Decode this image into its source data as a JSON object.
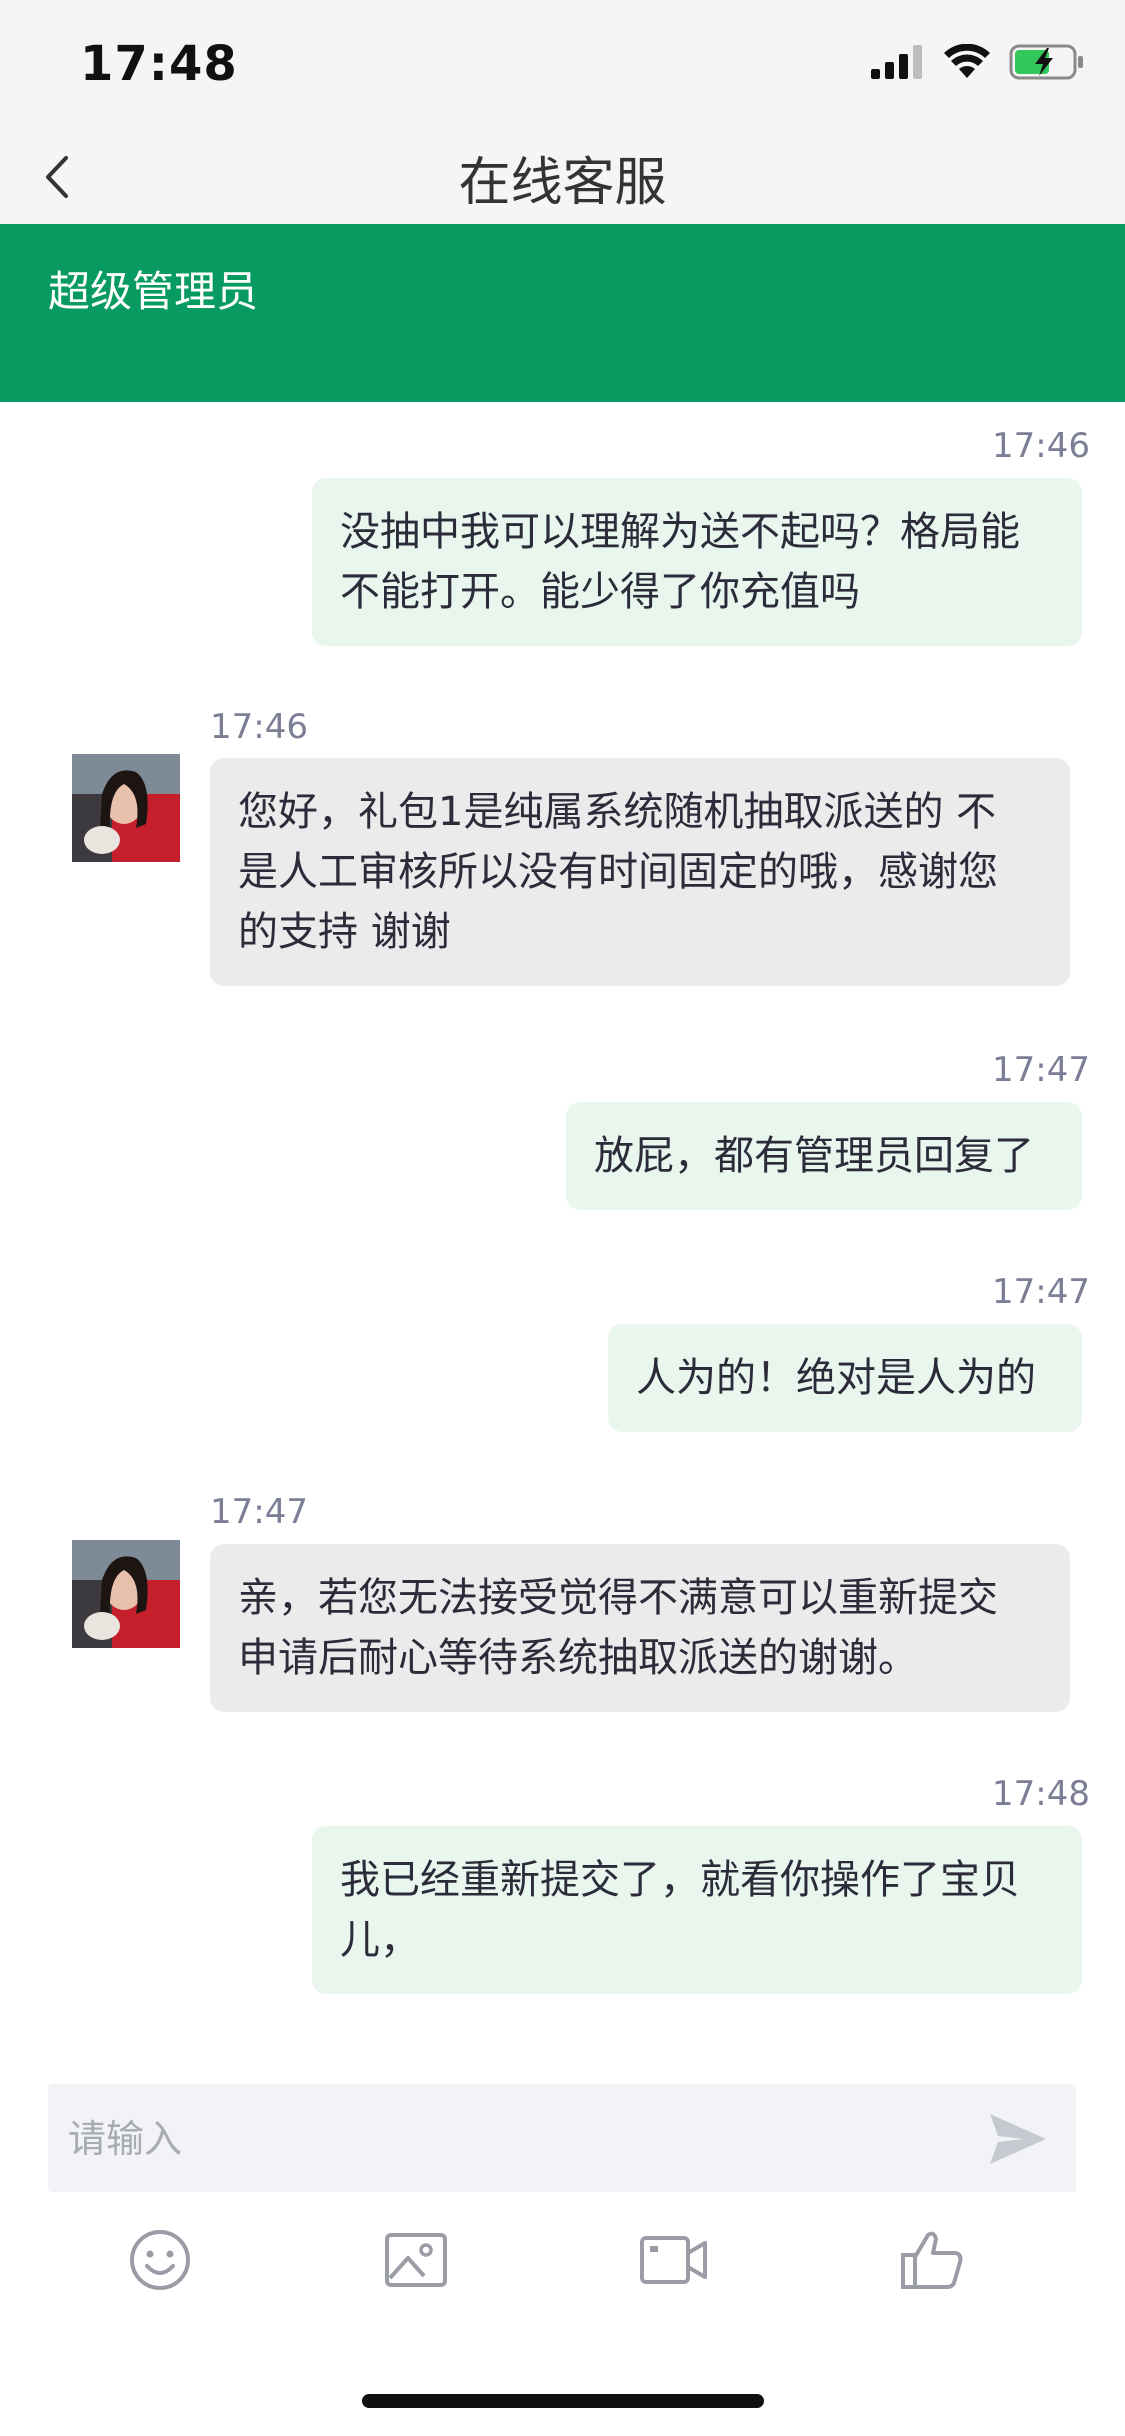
{
  "status_bar": {
    "time": "17:48"
  },
  "nav": {
    "title": "在线客服"
  },
  "banner": {
    "title": "超级管理员"
  },
  "messages": [
    {
      "direction": "out",
      "time": "17:46",
      "text_lines": [
        "没抽中我可以理解为送不起吗？格局能",
        "不能打开。能少得了你充值吗"
      ]
    },
    {
      "direction": "in",
      "time": "17:46",
      "text_lines": [
        "您好，礼包1是纯属系统随机抽取派送的 不",
        "是人工审核所以没有时间固定的哦，感谢您",
        "的支持 谢谢"
      ]
    },
    {
      "direction": "out",
      "time": "17:47",
      "text_lines": [
        "放屁，都有管理员回复了"
      ]
    },
    {
      "direction": "out",
      "time": "17:47",
      "text_lines": [
        "人为的！绝对是人为的"
      ]
    },
    {
      "direction": "in",
      "time": "17:47",
      "text_lines": [
        "亲，若您无法接受觉得不满意可以重新提交",
        "申请后耐心等待系统抽取派送的谢谢。"
      ]
    },
    {
      "direction": "out",
      "time": "17:48",
      "text_lines": [
        "我已经重新提交了，就看你操作了宝贝",
        "儿，"
      ]
    }
  ],
  "input": {
    "placeholder": "请输入",
    "value": ""
  },
  "toolbar": {
    "icons": [
      "emoji-icon",
      "image-icon",
      "video-icon",
      "thumbs-up-icon"
    ]
  },
  "colors": {
    "accent": "#079b62",
    "out_bubble": "#e8f6ee",
    "in_bubble": "#ebebec"
  }
}
